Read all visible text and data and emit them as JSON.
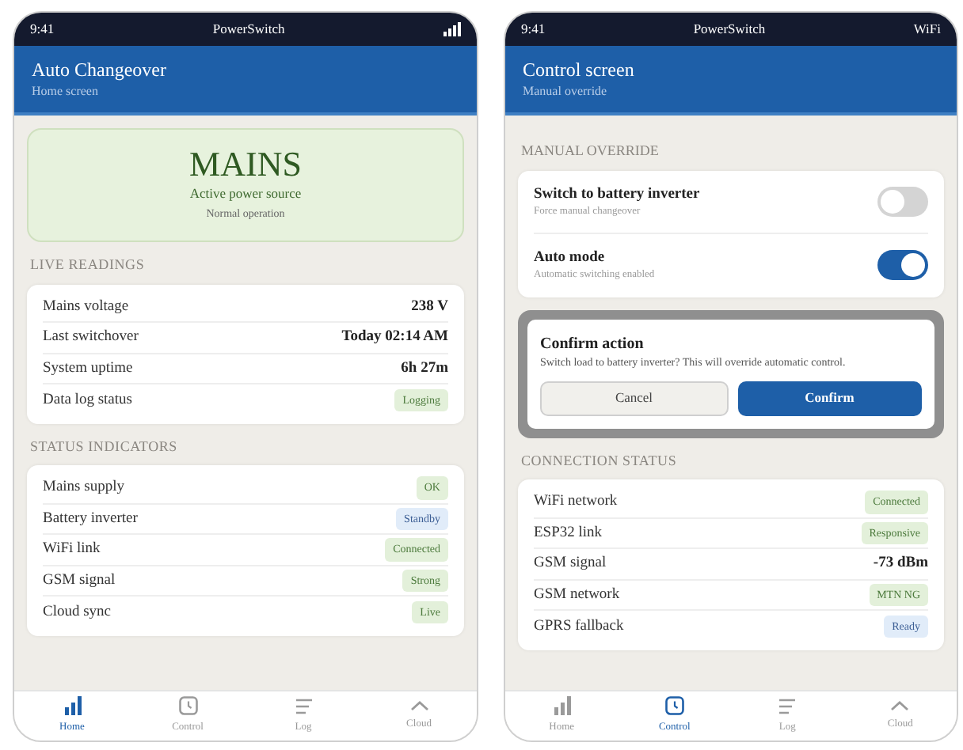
{
  "screens": [
    {
      "status_bar": {
        "time": "9:41",
        "title": "PowerSwitch"
      },
      "header": {
        "title": "Auto Changeover",
        "subtitle": "Home screen"
      },
      "hero": {
        "title": "MAINS",
        "subtitle": "Active power source",
        "note": "Normal operation"
      },
      "sections": [
        {
          "heading": "LIVE READINGS",
          "rows": [
            {
              "label": "Mains voltage",
              "kind": "text",
              "value": "238 V"
            },
            {
              "label": "Last switchover",
              "kind": "text",
              "value": "Today 02:14 AM"
            },
            {
              "label": "System uptime",
              "kind": "text",
              "value": "6h 27m"
            },
            {
              "label": "Data log status",
              "kind": "badge",
              "value": "Logging",
              "color": "#e3f0da"
            }
          ]
        },
        {
          "heading": "STATUS INDICATORS",
          "rows": [
            {
              "label": "Mains supply",
              "kind": "badge",
              "value": "OK",
              "color": "#e3f0da"
            },
            {
              "label": "Battery inverter",
              "kind": "badge",
              "value": "Standby",
              "color": "#e1ecf9"
            },
            {
              "label": "WiFi link",
              "kind": "badge",
              "value": "Connected",
              "color": "#e3f0da"
            },
            {
              "label": "GSM signal",
              "kind": "badge",
              "value": "Strong",
              "color": "#e3f0da"
            },
            {
              "label": "Cloud sync",
              "kind": "badge",
              "value": "Live",
              "color": "#e3f0da"
            }
          ]
        }
      ],
      "nav": [
        {
          "label": "Home",
          "kind": "chart",
          "selected": true
        },
        {
          "label": "Control",
          "kind": "clock",
          "selected": false
        },
        {
          "label": "Log",
          "kind": "lines",
          "selected": false
        },
        {
          "label": "Cloud",
          "kind": "chevron",
          "selected": false
        }
      ]
    },
    {
      "status_bar": {
        "time": "9:41",
        "title": "PowerSwitch",
        "right_text": "WiFi"
      },
      "header": {
        "title": "Control screen",
        "subtitle": "Manual override"
      },
      "toggles_heading": "MANUAL OVERRIDE",
      "toggles": [
        {
          "label": "Switch to battery inverter",
          "hint": "Force manual changeover",
          "on": false
        },
        {
          "label": "Auto mode",
          "hint": "Automatic switching enabled",
          "on": true
        }
      ],
      "dialog": {
        "title": "Confirm action",
        "message": "Switch load to battery inverter? This will override automatic control.",
        "buttons": [
          {
            "label": "Cancel",
            "kind": "secondary"
          },
          {
            "label": "Confirm",
            "kind": "primary"
          }
        ]
      },
      "sections": [
        {
          "heading": "CONNECTION STATUS",
          "rows": [
            {
              "label": "WiFi network",
              "kind": "badge",
              "value": "Connected",
              "color": "#e3f0da"
            },
            {
              "label": "ESP32 link",
              "kind": "badge",
              "value": "Responsive",
              "color": "#e3f0da"
            },
            {
              "label": "GSM signal",
              "kind": "text",
              "value": "-73 dBm"
            },
            {
              "label": "GSM network",
              "kind": "badge",
              "value": "MTN NG",
              "color": "#e3f0da"
            },
            {
              "label": "GPRS fallback",
              "kind": "badge",
              "value": "Ready",
              "color": "#e1ecf9"
            }
          ]
        }
      ],
      "nav": [
        {
          "label": "Home",
          "kind": "chart",
          "selected": false
        },
        {
          "label": "Control",
          "kind": "clock",
          "selected": true
        },
        {
          "label": "Log",
          "kind": "lines",
          "selected": false
        },
        {
          "label": "Cloud",
          "kind": "chevron",
          "selected": false
        }
      ]
    }
  ]
}
